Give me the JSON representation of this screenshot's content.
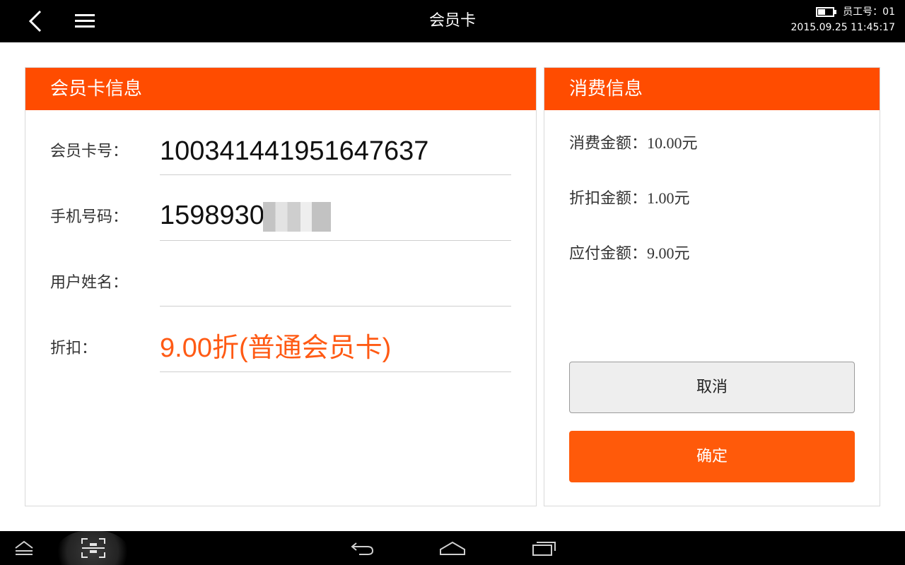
{
  "topbar": {
    "title": "会员卡",
    "employee": "员工号：01",
    "datetime": "2015.09.25 11:45:17",
    "battery_level": 0.45
  },
  "left_panel": {
    "header": "会员卡信息",
    "fields": [
      {
        "label": "会员卡号：",
        "value": "10034144195164763 7"
      },
      {
        "label": "手机号码：",
        "value": "1598930"
      },
      {
        "label": "用户姓名：",
        "value": ""
      },
      {
        "label": "折扣：",
        "value": "9.00折(普通会员卡)"
      }
    ]
  },
  "right_panel": {
    "header": "消费信息",
    "lines": [
      {
        "label": "消费金额：",
        "value": "10.00元"
      },
      {
        "label": "折扣金额：",
        "value": "1.00元"
      },
      {
        "label": "应付金额：",
        "value": "9.00元"
      }
    ],
    "cancel_label": "取消",
    "ok_label": "确定"
  },
  "icons": {
    "back": "back-arrow-icon",
    "menu": "hamburger-menu-icon",
    "battery": "battery-icon",
    "nav_hide": "hide-bar-icon",
    "nav_scan": "scan-icon",
    "nav_back": "nav-back-icon",
    "nav_home": "home-icon",
    "nav_recent": "recent-apps-icon"
  },
  "colors": {
    "accent": "#ff4c00",
    "discount_text": "#ff5a14",
    "topbar": "#000000"
  }
}
